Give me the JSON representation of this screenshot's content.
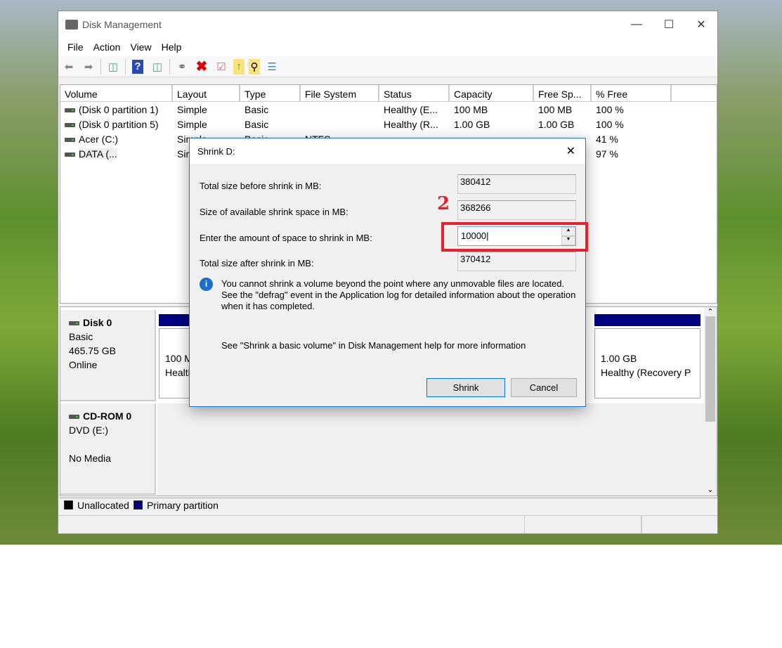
{
  "window": {
    "title": "Disk Management",
    "controls": [
      "minimize",
      "maximize",
      "close"
    ]
  },
  "menu": [
    "File",
    "Action",
    "View",
    "Help"
  ],
  "toolbar": [
    "back-icon",
    "forward-icon",
    "console-tree-icon",
    "help-icon",
    "action-pane-icon",
    "connect-disk-icon",
    "delete-icon",
    "properties-icon",
    "import-icon",
    "search-icon",
    "list-view-icon"
  ],
  "columns": [
    "Volume",
    "Layout",
    "Type",
    "File System",
    "Status",
    "Capacity",
    "Free Sp...",
    "% Free"
  ],
  "volumes": [
    {
      "volume": "(Disk 0 partition 1)",
      "layout": "Simple",
      "type": "Basic",
      "fs": "",
      "status": "Healthy (E...",
      "capacity": "100 MB",
      "free": "100 MB",
      "pct": "100 %"
    },
    {
      "volume": "(Disk 0 partition 5)",
      "layout": "Simple",
      "type": "Basic",
      "fs": "",
      "status": "Healthy (R...",
      "capacity": "1.00 GB",
      "free": "1.00 GB",
      "pct": "100 %"
    },
    {
      "volume": "Acer (C:)",
      "layout": "Simple",
      "type": "Basic",
      "fs": "NTFS",
      "status": "",
      "capacity": "",
      "free": "",
      "pct": "41 %"
    },
    {
      "volume": "DATA (...",
      "layout": "Simple",
      "type": "",
      "fs": "",
      "status": "",
      "capacity": "",
      "free": "",
      "pct": "97 %"
    }
  ],
  "disks": [
    {
      "name": "Disk 0",
      "lines": [
        "Basic",
        "465.75 GB",
        "Online"
      ],
      "partitions": [
        {
          "size": "100 MB",
          "status": "Healthy"
        },
        {
          "size": "1.00 GB",
          "status": "Healthy (Recovery P"
        }
      ]
    },
    {
      "name": "CD-ROM 0",
      "lines": [
        "DVD (E:)",
        "",
        "No Media"
      ]
    }
  ],
  "legend": [
    {
      "label": "Unallocated",
      "color": "#000000"
    },
    {
      "label": "Primary partition",
      "color": "#000080"
    }
  ],
  "dialog": {
    "title": "Shrink D:",
    "total_before_label": "Total size before shrink in MB:",
    "total_before": "380412",
    "available_label": "Size of available shrink space in MB:",
    "available": "368266",
    "amount_label": "Enter the amount of space to shrink in MB:",
    "amount": "10000",
    "total_after_label": "Total size after shrink in MB:",
    "total_after": "370412",
    "info": "You cannot shrink a volume beyond the point where any unmovable files are located. See the \"defrag\" event in the Application log for detailed information about the operation when it has completed.",
    "help": "See \"Shrink a basic volume\" in Disk Management help for more information",
    "shrink": "Shrink",
    "cancel": "Cancel"
  },
  "annotation": {
    "step": "2",
    "color": "#e8202a"
  }
}
